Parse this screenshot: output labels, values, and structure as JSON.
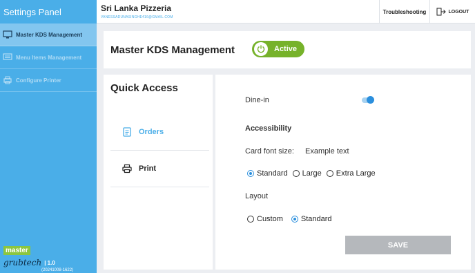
{
  "sidebar": {
    "title": "Settings Panel",
    "items": [
      {
        "label": "Master KDS Management",
        "icon": "monitor-icon"
      },
      {
        "label": "Menu Items Management",
        "icon": "menu-list-icon"
      },
      {
        "label": "Configure Printer",
        "icon": "printer-icon"
      }
    ],
    "brand": {
      "master": "master",
      "grubtech": "grubtech",
      "version": "| 1.0",
      "build": "(20241008-1622)"
    }
  },
  "header": {
    "store_name": "Sri Lanka Pizzeria",
    "store_email": "VANESSADUNASINGHE416@GMAIL.COM",
    "troubleshooting": "Troubleshooting",
    "logout": "LOGOUT"
  },
  "main": {
    "title": "Master KDS Management",
    "status": "Active"
  },
  "quick_access": {
    "title": "Quick Access",
    "items": [
      {
        "label": "Orders",
        "icon": "orders-icon"
      },
      {
        "label": "Print",
        "icon": "printer-icon"
      }
    ]
  },
  "settings": {
    "dine_in": "Dine-in",
    "dine_in_enabled": true,
    "accessibility": "Accessibility",
    "card_font_size": "Card font size:",
    "example_text": "Example text",
    "font_options": [
      "Standard",
      "Large",
      "Extra Large"
    ],
    "font_selected": "Standard",
    "layout": "Layout",
    "layout_options": [
      "Custom",
      "Standard"
    ],
    "layout_selected": "Standard",
    "save": "SAVE"
  },
  "colors": {
    "accent": "#4aaee8",
    "active": "#76b22a",
    "selected": "#2b8fdd",
    "disabled": "#b5b8bc"
  }
}
